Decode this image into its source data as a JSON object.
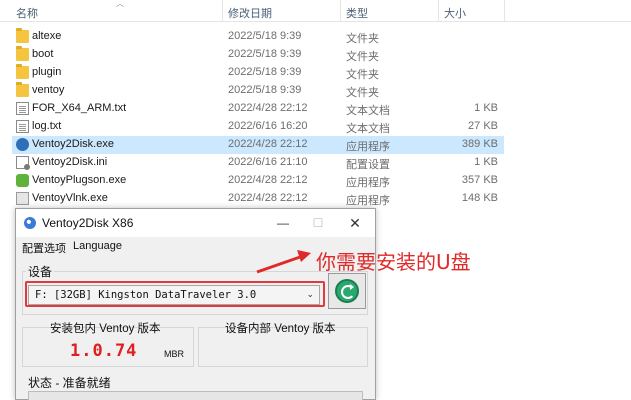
{
  "explorer": {
    "columns": {
      "name": "名称",
      "date": "修改日期",
      "type": "类型",
      "size": "大小"
    },
    "files": [
      {
        "icon": "folder-icon",
        "name": "altexe",
        "date": "2022/5/18 9:39",
        "type": "文件夹",
        "size": ""
      },
      {
        "icon": "folder-icon",
        "name": "boot",
        "date": "2022/5/18 9:39",
        "type": "文件夹",
        "size": ""
      },
      {
        "icon": "folder-icon",
        "name": "plugin",
        "date": "2022/5/18 9:39",
        "type": "文件夹",
        "size": ""
      },
      {
        "icon": "folder-icon",
        "name": "ventoy",
        "date": "2022/5/18 9:39",
        "type": "文件夹",
        "size": ""
      },
      {
        "icon": "text-file-icon",
        "name": "FOR_X64_ARM.txt",
        "date": "2022/4/28 22:12",
        "type": "文本文档",
        "size": "1 KB"
      },
      {
        "icon": "text-file-icon",
        "name": "log.txt",
        "date": "2022/6/16 16:20",
        "type": "文本文档",
        "size": "27 KB"
      },
      {
        "icon": "ventoy-exe-icon",
        "name": "Ventoy2Disk.exe",
        "date": "2022/4/28 22:12",
        "type": "应用程序",
        "size": "389 KB",
        "selected": true
      },
      {
        "icon": "config-file-icon",
        "name": "Ventoy2Disk.ini",
        "date": "2022/6/16 21:10",
        "type": "配置设置",
        "size": "1 KB"
      },
      {
        "icon": "plugin-exe-icon",
        "name": "VentoyPlugson.exe",
        "date": "2022/4/28 22:12",
        "type": "应用程序",
        "size": "357 KB"
      },
      {
        "icon": "vlnk-exe-icon",
        "name": "VentoyVlnk.exe",
        "date": "2022/4/28 22:12",
        "type": "应用程序",
        "size": "148 KB"
      }
    ]
  },
  "window": {
    "title": "Ventoy2Disk  X86",
    "controls": {
      "minimize": "—",
      "maximize": "☐",
      "close": "✕"
    },
    "menu": {
      "config": "配置选项",
      "language": "Language"
    },
    "device_group_label": "设备",
    "device_value": "F: [32GB] Kingston DataTraveler 3.0",
    "package_version_label": "安装包内 Ventoy 版本",
    "package_version": "1.0.74",
    "partition_style": "MBR",
    "device_version_label": "设备内部 Ventoy 版本",
    "device_version": "",
    "status_label": "状态 - 准备就绪"
  },
  "annotation": {
    "text": "你需要安装的U盘",
    "color": "#e02a2a"
  },
  "colors": {
    "selected_row": "#cce8ff",
    "version_red": "#e02020",
    "refresh_green": "#2aa86d"
  }
}
